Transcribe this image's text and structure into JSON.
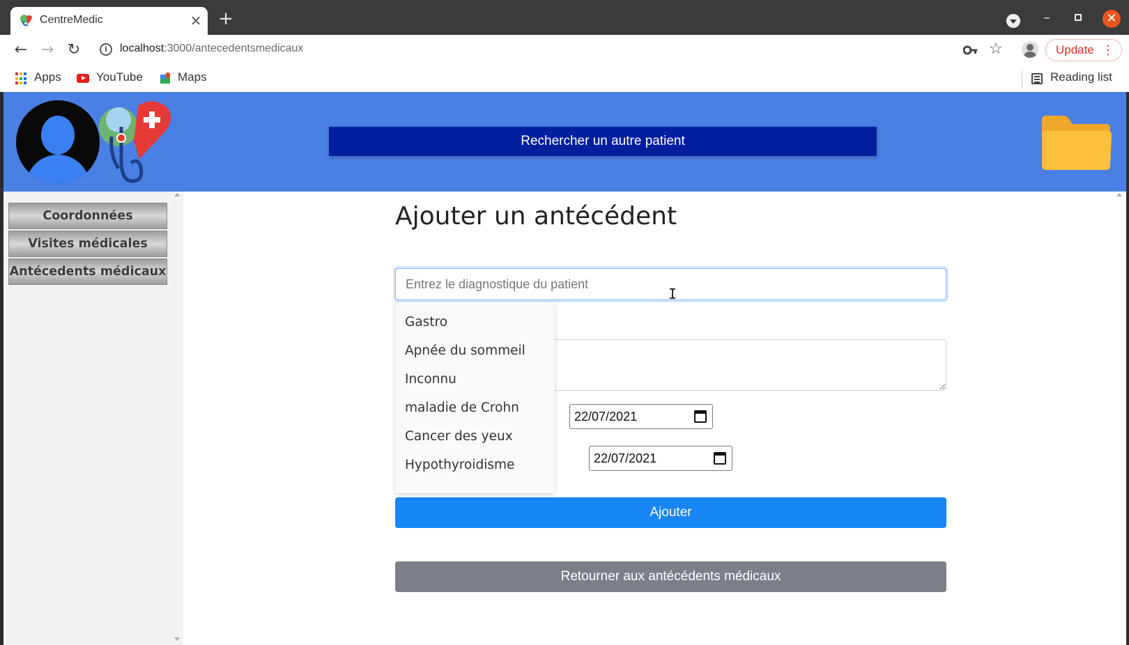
{
  "browser": {
    "tab_title": "CentreMedic",
    "tab_close": "×",
    "new_tab": "+",
    "url_host": "localhost",
    "url_path": ":3000/antecedentsmedicaux",
    "update_label": "Update",
    "bookmarks": {
      "apps": "Apps",
      "youtube": "YouTube",
      "maps": "Maps",
      "reading_list": "Reading list"
    }
  },
  "header": {
    "search_patient_label": "Rechercher un autre patient",
    "accent_color": "#4a80e4",
    "button_color": "#001e9e"
  },
  "sidebar": {
    "items": [
      {
        "label": "Coordonnées"
      },
      {
        "label": "Visites médicales"
      },
      {
        "label": "Antécedents médicaux"
      }
    ]
  },
  "form": {
    "title": "Ajouter un antécédent",
    "diagnostic_placeholder": "Entrez le diagnostique du patient",
    "diagnostic_value": "",
    "date_start": "22/07/2021",
    "date_end": "22/07/2021",
    "submit_label": "Ajouter",
    "back_label": "Retourner aux antécédents médicaux"
  },
  "suggestions": [
    "Gastro",
    "Apnée du sommeil",
    "Inconnu",
    "maladie de Crohn",
    "Cancer des yeux",
    "Hypothyroidisme"
  ]
}
